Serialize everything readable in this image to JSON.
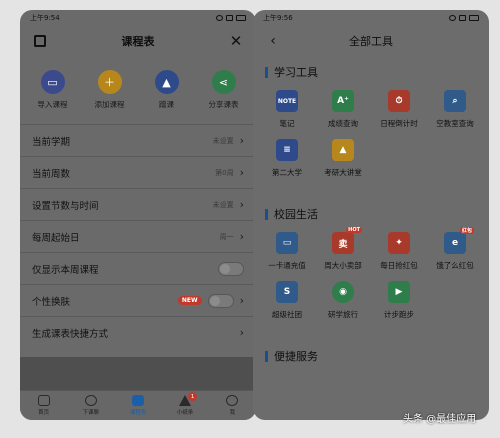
{
  "left_screen": {
    "status_time": "上午9:54",
    "title": "课程表",
    "quick_actions": [
      {
        "label": "导入课程",
        "icon": "import-icon",
        "color": "#3b4a8c"
      },
      {
        "label": "添加课程",
        "icon": "add-course-icon",
        "color": "#b8871c"
      },
      {
        "label": "蹭课",
        "icon": "graduation-cap-icon",
        "color": "#2f4a8a"
      },
      {
        "label": "分享课表",
        "icon": "share-icon",
        "color": "#2e7d4a"
      }
    ],
    "settings": [
      {
        "label": "当前学期",
        "value": "未设置"
      },
      {
        "label": "当前周数",
        "value": "第0周"
      },
      {
        "label": "设置节数与时间",
        "value": "未设置"
      },
      {
        "label": "每周起始日",
        "value": "周一"
      },
      {
        "label": "仅显示本周课程",
        "value": ""
      },
      {
        "label": "个性换肤",
        "value": "",
        "badge": "NEW"
      },
      {
        "label": "生成课表快捷方式",
        "value": ""
      }
    ],
    "tabs": [
      {
        "label": "首页",
        "icon": "home-icon"
      },
      {
        "label": "下课聊",
        "icon": "chat-icon"
      },
      {
        "label": "课程表",
        "icon": "schedule-icon",
        "active": true
      },
      {
        "label": "小纸条",
        "icon": "paper-plane-icon",
        "badge": "1"
      },
      {
        "label": "我",
        "icon": "profile-icon"
      }
    ]
  },
  "right_screen": {
    "status_time": "上午9:56",
    "title": "全部工具",
    "sections": [
      {
        "title": "学习工具",
        "tools": [
          {
            "label": "笔记",
            "icon": "note-icon",
            "glyph": "NOTE",
            "color": "#2f4a8a"
          },
          {
            "label": "成绩查询",
            "icon": "grade-icon",
            "glyph": "A⁺",
            "color": "#2e7d4a"
          },
          {
            "label": "日程倒计时",
            "icon": "countdown-icon",
            "glyph": "⏱",
            "color": "#a83a2c"
          },
          {
            "label": "空教室查询",
            "icon": "classroom-search-icon",
            "glyph": "⌕",
            "color": "#2f5a8a"
          },
          {
            "label": "第二大学",
            "icon": "book-icon",
            "glyph": "≡",
            "color": "#2f4a8a"
          },
          {
            "label": "考研大讲堂",
            "icon": "graduation-cap-icon",
            "glyph": "▲",
            "color": "#b8871c"
          }
        ]
      },
      {
        "title": "校园生活",
        "tools": [
          {
            "label": "一卡通充值",
            "icon": "card-icon",
            "glyph": "▭",
            "color": "#2f5a8a"
          },
          {
            "label": "周大小卖部",
            "icon": "shop-icon",
            "glyph": "卖",
            "color": "#a83a2c",
            "tag": "HOT"
          },
          {
            "label": "每日抢红包",
            "icon": "red-packet-icon",
            "glyph": "✦",
            "color": "#a83a2c"
          },
          {
            "label": "饿了么红包",
            "icon": "eleme-icon",
            "glyph": "e",
            "color": "#2f5a8a",
            "tag": "红包"
          },
          {
            "label": "超级社团",
            "icon": "club-icon",
            "glyph": "S",
            "color": "#2f5a8a"
          },
          {
            "label": "研学旅行",
            "icon": "travel-icon",
            "glyph": "◉",
            "color": "#2e7d4a"
          },
          {
            "label": "计步跑步",
            "icon": "running-icon",
            "glyph": "▶",
            "color": "#2e7d4a"
          }
        ]
      },
      {
        "title": "便捷服务",
        "tools": []
      }
    ]
  },
  "watermark": "头条 @最佳应用"
}
